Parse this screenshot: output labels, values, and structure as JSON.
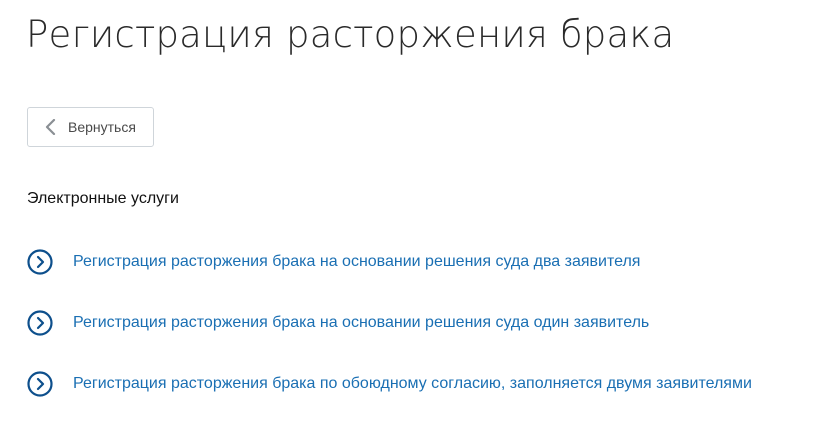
{
  "page": {
    "title": "Регистрация расторжения брака"
  },
  "back_button": {
    "label": "Вернуться",
    "icon": "chevron-left-icon"
  },
  "section": {
    "heading": "Электронные услуги"
  },
  "services": [
    {
      "label": "Регистрация расторжения брака на основании решения суда два заявителя",
      "icon": "circle-chevron-right-icon"
    },
    {
      "label": "Регистрация расторжения брака на основании решения суда один заявитель",
      "icon": "circle-chevron-right-icon"
    },
    {
      "label": "Регистрация расторжения брака по обоюдному согласию, заполняется двумя заявителями",
      "icon": "circle-chevron-right-icon"
    }
  ],
  "colors": {
    "link": "#1a6fb3",
    "icon_ring": "#0d4f8c",
    "title_text": "#2a2a2a",
    "button_border": "#cfd5da"
  }
}
